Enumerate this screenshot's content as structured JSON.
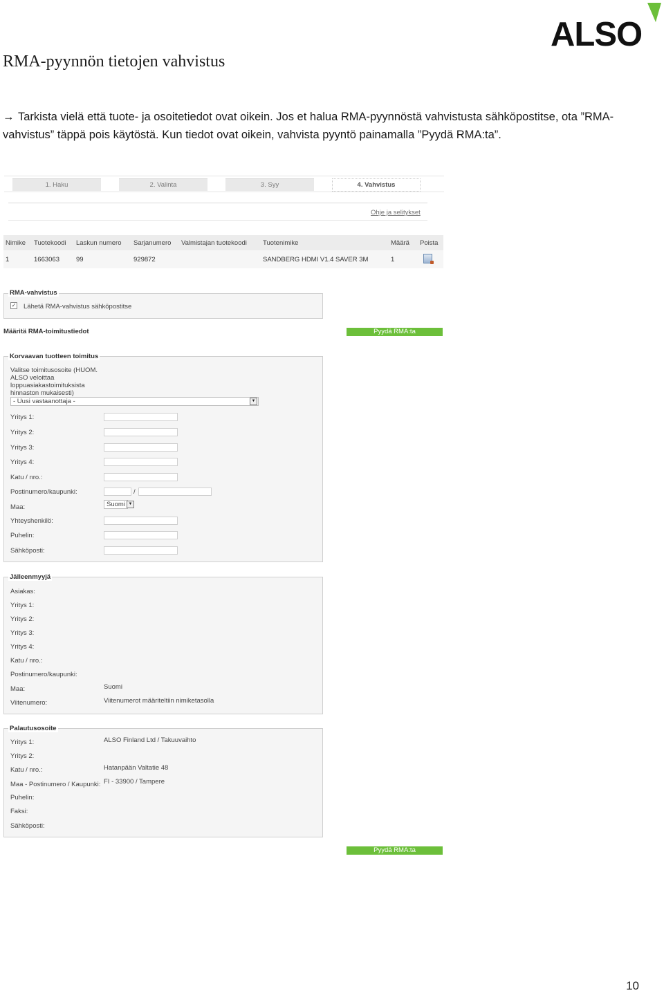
{
  "logo": {
    "text": "ALSO",
    "accent_color": "#6cbf3a"
  },
  "document": {
    "title": "RMA-pyynnön tietojen vahvistus",
    "intro": "Tarkista vielä että tuote- ja osoitetiedot ovat oikein.  Jos et halua RMA-pyynnöstä vahvistusta sähköpostitse, ota ”RMA-vahvistus” täppä pois käytöstä. Kun tiedot ovat oikein, vahvista pyyntö painamalla ”Pyydä RMA:ta”.",
    "page_number": "10"
  },
  "steps": [
    "1. Haku",
    "2. Valinta",
    "3. Syy",
    "4. Vahvistus"
  ],
  "help_link": "Ohje ja selitykset",
  "table": {
    "headers": [
      "Nimike",
      "Tuotekoodi",
      "Laskun numero",
      "Sarjanumero",
      "Valmistajan tuotekoodi",
      "Tuotenimike",
      "Määrä",
      "Poista"
    ],
    "row": [
      "1",
      "1663063",
      "99",
      "929872",
      "",
      "SANDBERG HDMI V1.4 SAVER 3M",
      "1"
    ]
  },
  "rma_confirmation": {
    "legend": "RMA-vahvistus",
    "checkbox_label": "Lähetä RMA-vahvistus sähköpostitse",
    "checked": true
  },
  "delivery_info_title": "Määritä RMA-toimitustiedot",
  "request_button": "Pyydä RMA:ta",
  "replacement": {
    "legend": "Korvaavan tuotteen toimitus",
    "note": [
      "Valitse toimitusosoite (HUOM.",
      "ALSO veloittaa",
      "loppuasiakastoimituksista",
      "hinnaston mukaisesti)"
    ],
    "select_value": "- Uusi vastaanottaja -",
    "fields": [
      "Yritys 1:",
      "Yritys 2:",
      "Yritys 3:",
      "Yritys 4:",
      "Katu / nro.:",
      "Postinumero/kaupunki:",
      "Maa:",
      "Yhteyshenkilö:",
      "Puhelin:",
      "Sähköposti:"
    ],
    "postal_separator": "/",
    "country_value": "Suomi"
  },
  "reseller": {
    "legend": "Jälleenmyyjä",
    "fields": [
      "Asiakas:",
      "Yritys 1:",
      "Yritys 2:",
      "Yritys 3:",
      "Yritys 4:",
      "Katu / nro.:",
      "Postinumero/kaupunki:",
      "Maa:",
      "Viitenumero:"
    ],
    "country_value": "Suomi",
    "reference_value": "Viitenumerot määriteltiin nimiketasolla"
  },
  "return_address": {
    "legend": "Palautusosoite",
    "fields": [
      "Yritys 1:",
      "Yritys 2:",
      "Katu / nro.:",
      "Maa - Postinumero / Kaupunki:",
      "Puhelin:",
      "Faksi:",
      "Sähköposti:"
    ],
    "company_value": "ALSO Finland Ltd / Takuuvaihto",
    "street_value": "Hatanpään Valtatie 48",
    "city_value": "FI - 33900 / Tampere"
  }
}
